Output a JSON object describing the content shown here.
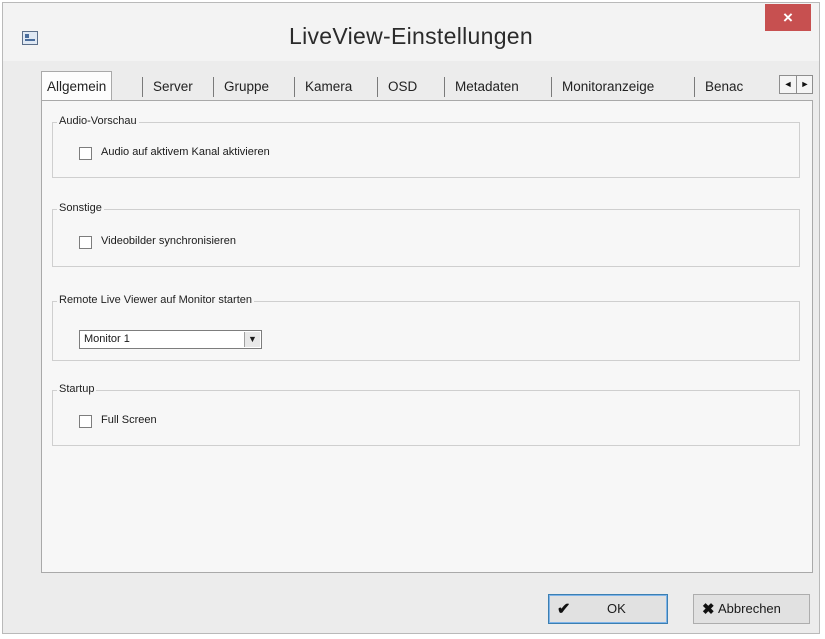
{
  "window": {
    "title": "LiveView-Einstellungen",
    "close_glyph": "×",
    "app_icon": "settings-window-icon"
  },
  "tabs": [
    {
      "label": "Allgemein",
      "active": true
    },
    {
      "label": "Server",
      "active": false
    },
    {
      "label": "Gruppe",
      "active": false
    },
    {
      "label": "Kamera",
      "active": false
    },
    {
      "label": "OSD",
      "active": false
    },
    {
      "label": "Metadaten",
      "active": false
    },
    {
      "label": "Monitoranzeige",
      "active": false
    },
    {
      "label": "Benac",
      "active": false
    }
  ],
  "tab_scroll": {
    "left": "◄",
    "right": "►"
  },
  "groups": {
    "audio": {
      "label": "Audio-Vorschau",
      "checkbox_label": "Audio auf aktivem Kanal aktivieren",
      "checked": false
    },
    "misc": {
      "label": "Sonstige",
      "checkbox_label": "Videobilder synchronisieren",
      "checked": false
    },
    "remote": {
      "label": "Remote Live Viewer auf Monitor starten",
      "selected_value": "Monitor 1"
    },
    "startup": {
      "label": "Startup",
      "checkbox_label": "Full Screen",
      "checked": false
    }
  },
  "buttons": {
    "ok_label": "OK",
    "ok_icon": "✔",
    "cancel_label": "Abbrechen",
    "cancel_icon": "✖"
  },
  "colors": {
    "close_button": "#c75050",
    "default_button_border": "#3c7fb1"
  }
}
